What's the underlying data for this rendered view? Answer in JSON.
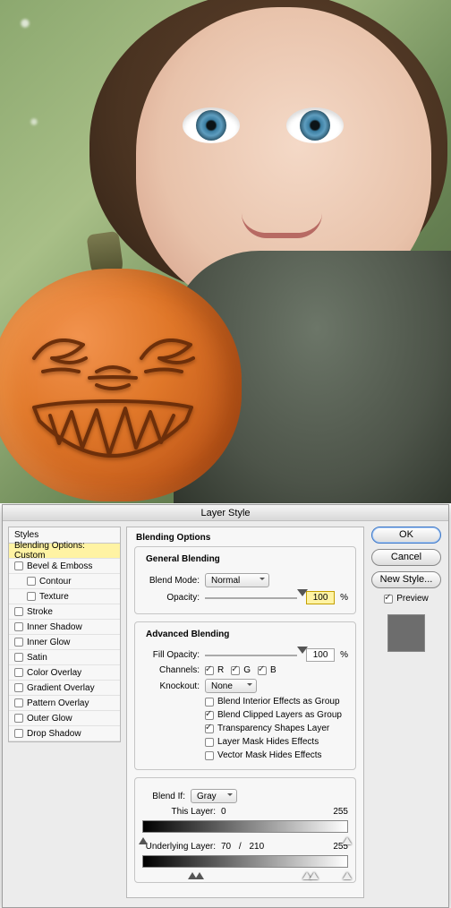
{
  "dialog": {
    "title": "Layer Style",
    "styles_header": "Styles",
    "style_items": [
      {
        "label": "Blending Options: Custom",
        "selected": true,
        "checkbox": false,
        "indent": false
      },
      {
        "label": "Bevel & Emboss",
        "selected": false,
        "checkbox": true,
        "checked": false,
        "indent": false
      },
      {
        "label": "Contour",
        "selected": false,
        "checkbox": true,
        "checked": false,
        "indent": true
      },
      {
        "label": "Texture",
        "selected": false,
        "checkbox": true,
        "checked": false,
        "indent": true
      },
      {
        "label": "Stroke",
        "selected": false,
        "checkbox": true,
        "checked": false,
        "indent": false
      },
      {
        "label": "Inner Shadow",
        "selected": false,
        "checkbox": true,
        "checked": false,
        "indent": false
      },
      {
        "label": "Inner Glow",
        "selected": false,
        "checkbox": true,
        "checked": false,
        "indent": false
      },
      {
        "label": "Satin",
        "selected": false,
        "checkbox": true,
        "checked": false,
        "indent": false
      },
      {
        "label": "Color Overlay",
        "selected": false,
        "checkbox": true,
        "checked": false,
        "indent": false
      },
      {
        "label": "Gradient Overlay",
        "selected": false,
        "checkbox": true,
        "checked": false,
        "indent": false
      },
      {
        "label": "Pattern Overlay",
        "selected": false,
        "checkbox": true,
        "checked": false,
        "indent": false
      },
      {
        "label": "Outer Glow",
        "selected": false,
        "checkbox": true,
        "checked": false,
        "indent": false
      },
      {
        "label": "Drop Shadow",
        "selected": false,
        "checkbox": true,
        "checked": false,
        "indent": false
      }
    ],
    "panel_title": "Blending Options",
    "general_blending": {
      "title": "General Blending",
      "blend_mode_label": "Blend Mode:",
      "blend_mode_value": "Normal",
      "opacity_label": "Opacity:",
      "opacity_value": "100",
      "pct": "%"
    },
    "advanced_blending": {
      "title": "Advanced Blending",
      "fill_opacity_label": "Fill Opacity:",
      "fill_opacity_value": "100",
      "pct": "%",
      "channels_label": "Channels:",
      "channels": {
        "r": "R",
        "g": "G",
        "b": "B"
      },
      "knockout_label": "Knockout:",
      "knockout_value": "None",
      "opt1": "Blend Interior Effects as Group",
      "opt2": "Blend Clipped Layers as Group",
      "opt3": "Transparency Shapes Layer",
      "opt4": "Layer Mask Hides Effects",
      "opt5": "Vector Mask Hides Effects"
    },
    "blend_if": {
      "label": "Blend If:",
      "value": "Gray",
      "this_layer_label": "This Layer:",
      "this_layer_low": "0",
      "this_layer_high": "255",
      "underlying_label": "Underlying Layer:",
      "underlying_low": "70",
      "underlying_mid": "210",
      "underlying_high": "255"
    },
    "buttons": {
      "ok": "OK",
      "cancel": "Cancel",
      "new_style": "New Style...",
      "preview": "Preview"
    }
  }
}
